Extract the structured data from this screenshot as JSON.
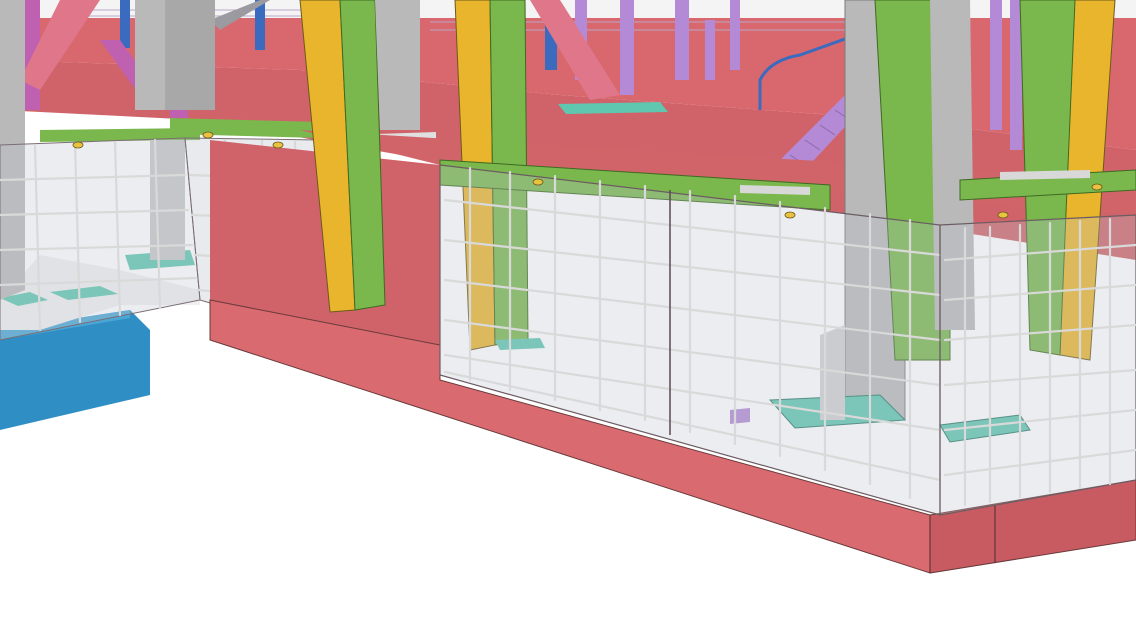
{
  "view": {
    "kind": "3d-bim-model-viewport",
    "colors": {
      "background": "#ffffff",
      "concrete": "#d96a70",
      "concrete_dark": "#c85b61",
      "concrete_top": "#cf6369",
      "steel_yellow": "#e8b52c",
      "steel_green": "#7ab84d",
      "steel_grey": "#b9b9b9",
      "steel_purple": "#b48ad6",
      "steel_magenta": "#c060b0",
      "bracing_pink": "#e0768a",
      "base_plate_teal": "#5fc6b0",
      "blue_block": "#2f8fc4",
      "rebar": "#d8d8d8",
      "formwork_glass": "rgba(180,190,200,0.25)"
    }
  }
}
